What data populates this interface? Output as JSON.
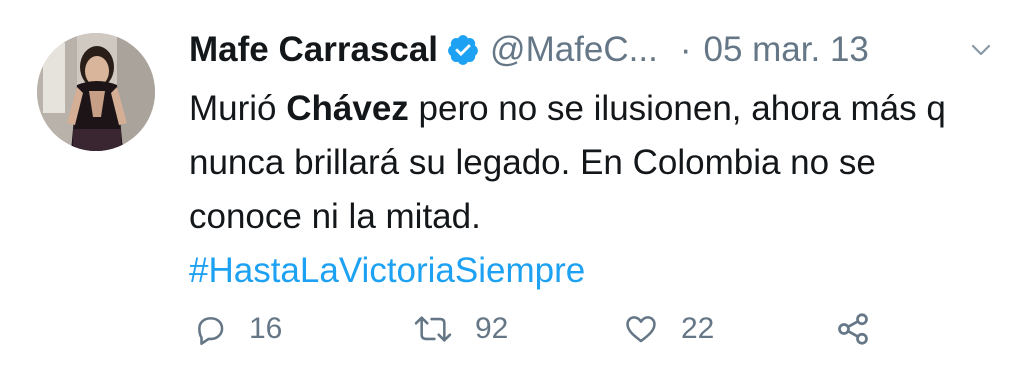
{
  "tweet": {
    "display_name": "Mafe Carrascal",
    "handle": "@MafeC...",
    "separator": "·",
    "date": "05 mar. 13",
    "text_part1": "Murió ",
    "text_bold": "Chávez",
    "text_part2": " pero no se ilusionen, ahora más q nunca brillará su legado. En Colombia no se conoce ni la mitad.",
    "hashtag": "#HastaLaVictoriaSiempre"
  },
  "actions": {
    "replies": "16",
    "retweets": "92",
    "likes": "22"
  },
  "icons": {
    "verified": "verified-badge-icon",
    "menu": "chevron-down-icon",
    "reply": "reply-icon",
    "retweet": "retweet-icon",
    "like": "heart-icon",
    "share": "share-icon"
  },
  "colors": {
    "text": "#14171a",
    "secondary": "#657786",
    "link": "#1da1f2",
    "verified": "#1da1f2"
  }
}
